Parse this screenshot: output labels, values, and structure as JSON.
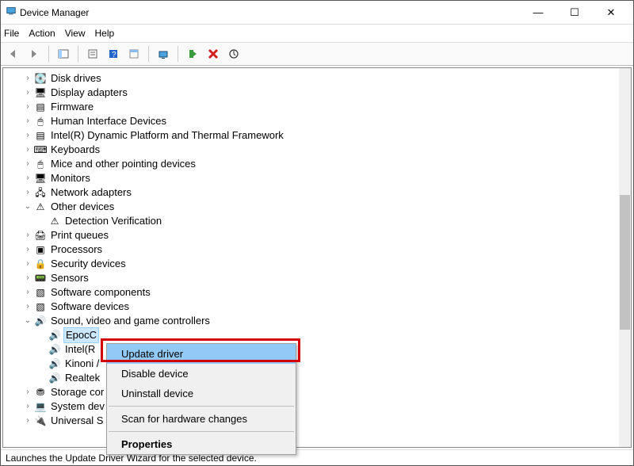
{
  "window": {
    "title": "Device Manager"
  },
  "menu": {
    "file": "File",
    "action": "Action",
    "view": "View",
    "help": "Help"
  },
  "tree": {
    "disk_drives": "Disk drives",
    "display_adapters": "Display adapters",
    "firmware": "Firmware",
    "hid": "Human Interface Devices",
    "intel_dptf": "Intel(R) Dynamic Platform and Thermal Framework",
    "keyboards": "Keyboards",
    "mice": "Mice and other pointing devices",
    "monitors": "Monitors",
    "network_adapters": "Network adapters",
    "other_devices": "Other devices",
    "detection_verification": "Detection Verification",
    "print_queues": "Print queues",
    "processors": "Processors",
    "security_devices": "Security devices",
    "sensors": "Sensors",
    "software_components": "Software components",
    "software_devices": "Software devices",
    "sound_video": "Sound, video and game controllers",
    "epoc": "EpocC",
    "intel_audio": "Intel(R",
    "kinoni": "Kinoni /",
    "realtek": "Realtek",
    "storage": "Storage cor",
    "system_dev": "System dev",
    "usb": "Universal S"
  },
  "contextmenu": {
    "update_driver": "Update driver",
    "disable_device": "Disable device",
    "uninstall_device": "Uninstall device",
    "scan_hardware": "Scan for hardware changes",
    "properties": "Properties"
  },
  "statusbar": {
    "text": "Launches the Update Driver Wizard for the selected device."
  }
}
